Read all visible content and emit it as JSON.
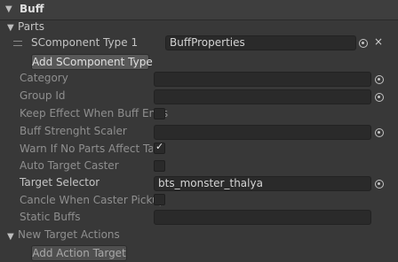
{
  "header": {
    "title": "Buff"
  },
  "parts": {
    "foldout_label": "Parts",
    "items": [
      {
        "label": "SComponent Type 1",
        "value": "BuffProperties"
      }
    ],
    "add_button": "Add SComponent Type"
  },
  "fields": {
    "category": {
      "label": "Category",
      "value": ""
    },
    "group_id": {
      "label": "Group Id",
      "value": ""
    },
    "keep_effect": {
      "label": "Keep Effect When Buff Ends",
      "checked": false
    },
    "buff_strength_scaler": {
      "label": "Buff Strenght Scaler",
      "value": ""
    },
    "warn_if_no_parts": {
      "label": "Warn If No Parts Affect Targe",
      "checked": true
    },
    "auto_target_caster": {
      "label": "Auto Target Caster",
      "checked": false
    },
    "target_selector": {
      "label": "Target Selector",
      "value": "bts_monster_thalya"
    },
    "cancel_when_caster_pickup": {
      "label": "Cancle When Caster Pickup",
      "checked": false
    },
    "static_buffs": {
      "label": "Static Buffs",
      "value": ""
    }
  },
  "new_target_actions": {
    "foldout_label": "New Target Actions",
    "add_button": "Add Action Target"
  },
  "icons": {
    "collapse": "triangle-down-icon",
    "object_picker": "object-picker-icon",
    "remove": "close-icon",
    "checkmark": "checkmark-icon",
    "drag": "drag-handle-icon"
  }
}
